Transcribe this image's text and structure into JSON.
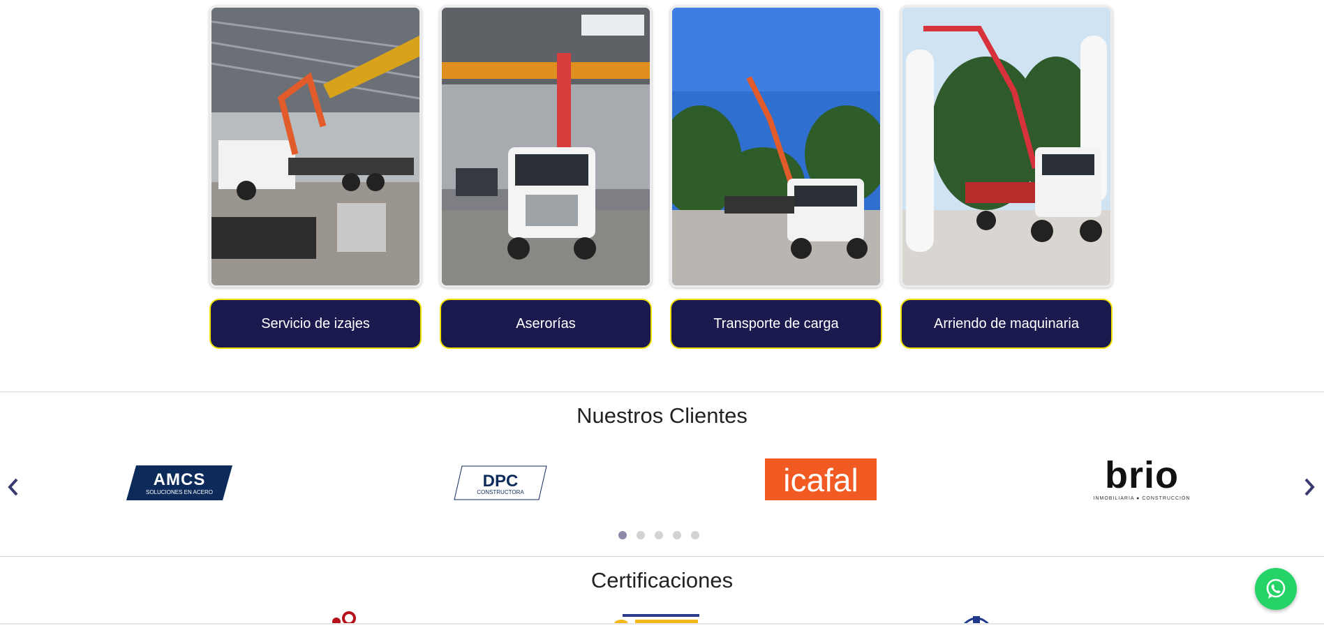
{
  "services": [
    {
      "label": "Servicio de izajes",
      "image": "crane-truck-warehouse-photo"
    },
    {
      "label": "Aserorías",
      "image": "crane-truck-front-photo"
    },
    {
      "label": "Transporte de carga",
      "image": "crane-truck-outdoor-photo"
    },
    {
      "label": "Arriendo de maquinaria",
      "image": "crane-truck-tanks-photo"
    }
  ],
  "clients": {
    "title": "Nuestros Clientes",
    "logos": [
      {
        "name": "AMCS",
        "tagline": "SOLUCIONES EN ACERO",
        "color": "#0d2b5a"
      },
      {
        "name": "DPC",
        "tagline": "CONSTRUCTORA",
        "color": "#0d2b5a"
      },
      {
        "name": "icafal",
        "color": "#f15a22"
      },
      {
        "name": "brio",
        "tagline": "INMOBILIARIA ● CONSTRUCCIÓN",
        "color": "#111111"
      }
    ],
    "prev_icon": "chevron-left-icon",
    "next_icon": "chevron-right-icon",
    "page_count": 5,
    "active_page": 1
  },
  "certifications": {
    "title": "Certificaciones"
  },
  "whatsapp": {
    "icon": "whatsapp-icon",
    "color": "#25d366"
  },
  "colors": {
    "button_bg": "#1b1a4f",
    "button_border": "#f3e100",
    "arrow": "#3b3a6e"
  }
}
